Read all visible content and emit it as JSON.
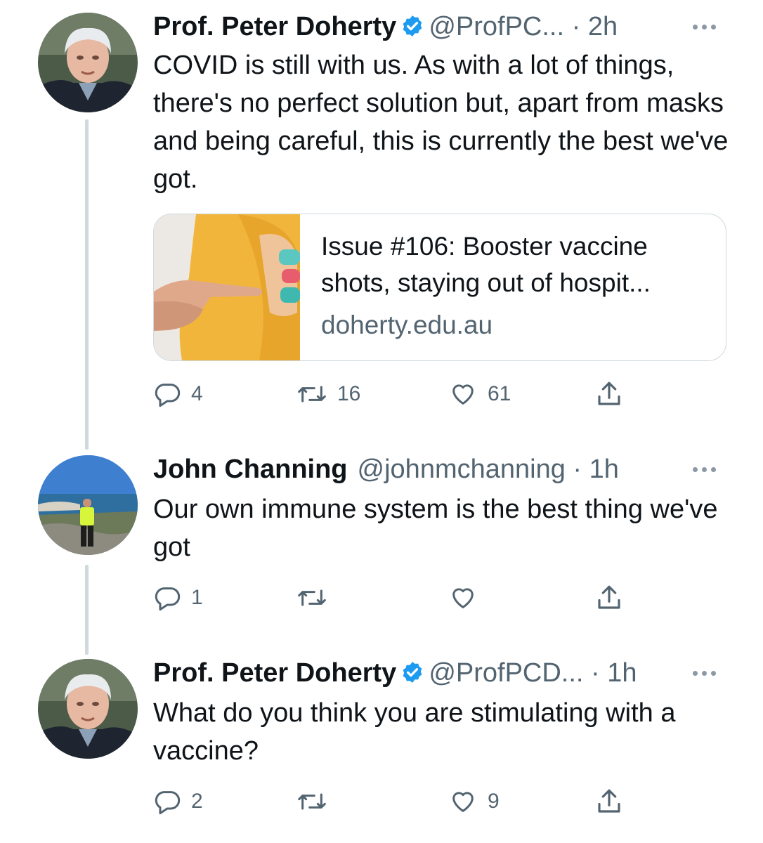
{
  "tweets": [
    {
      "name": "Prof. Peter Doherty",
      "handle": "@ProfPC...",
      "time": "2h",
      "text": "COVID is still with us. As with a lot of things, there's no perfect solution but, apart from masks and being careful, this is currently the best we've got.",
      "verified": true,
      "card": {
        "title": "Issue #106: Booster vaccine shots, staying out of hospit...",
        "domain": "doherty.edu.au"
      },
      "stats": {
        "replies": "4",
        "retweets": "16",
        "likes": "61"
      }
    },
    {
      "name": "John Channing",
      "handle": "@johnmchanning",
      "time": "1h",
      "text": "Our own immune system is the best thing we've got",
      "verified": false,
      "stats": {
        "replies": "1",
        "retweets": "",
        "likes": ""
      }
    },
    {
      "name": "Prof. Peter Doherty",
      "handle": "@ProfPCD...",
      "time": "1h",
      "text": "What do you think you are stimulating with a vaccine?",
      "verified": true,
      "stats": {
        "replies": "2",
        "retweets": "",
        "likes": "9"
      }
    }
  ],
  "separator": "·",
  "icons": {
    "reply": "reply-icon",
    "retweet": "retweet-icon",
    "like": "heart-icon",
    "share": "share-icon",
    "more": "more-icon",
    "verified": "verified-badge-icon"
  },
  "colors": {
    "verified": "#1d9bf0",
    "muted": "#536471",
    "text": "#0f1419",
    "thread_line": "#cfd9de"
  }
}
